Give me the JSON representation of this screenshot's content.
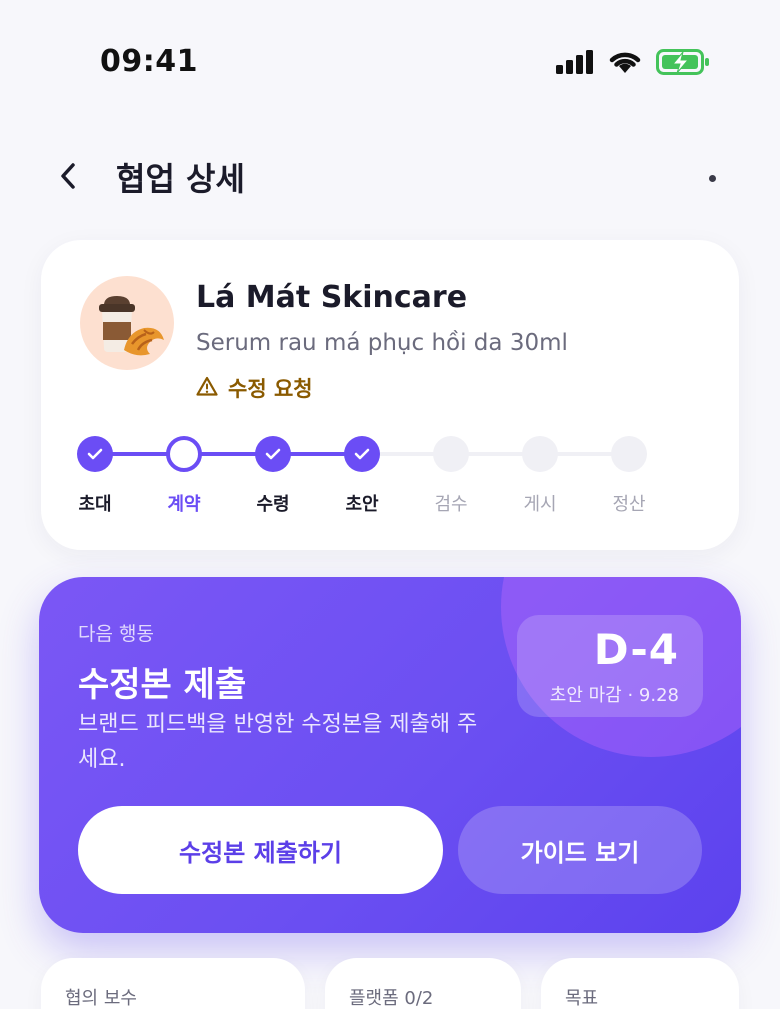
{
  "status_bar": {
    "time": "09:41",
    "icons": [
      "signal-icon",
      "wifi-icon",
      "battery-charging-icon"
    ]
  },
  "nav": {
    "title": "협업 상세",
    "back_icon": "chevron-left-icon",
    "more_icon": "more-horizontal-icon"
  },
  "collab": {
    "brand": "Lá Mát Skincare",
    "product": "Serum rau má phục hồi da 30ml",
    "status_icon": "warning-icon",
    "status_label": "수정 요청",
    "steps": [
      {
        "label": "초대",
        "state": "done"
      },
      {
        "label": "계약",
        "state": "current"
      },
      {
        "label": "수령",
        "state": "done"
      },
      {
        "label": "초안",
        "state": "done"
      },
      {
        "label": "검수",
        "state": "todo"
      },
      {
        "label": "게시",
        "state": "todo"
      },
      {
        "label": "정산",
        "state": "todo"
      }
    ]
  },
  "next_action": {
    "eyebrow": "다음 행동",
    "title": "수정본 제출",
    "description": "브랜드 피드백을 반영한 수정본을 제출해 주세요.",
    "dday": "D-4",
    "deadline": "초안 마감 · 9.28",
    "primary_button": "수정본 제출하기",
    "secondary_button": "가이드 보기"
  },
  "info_cards": [
    {
      "label": "협의 보수"
    },
    {
      "label": "플랫폼 0/2"
    },
    {
      "label": "목표"
    }
  ],
  "colors": {
    "accent": "#6b4df5",
    "warning": "#8a5a00",
    "background": "#f7f7fb"
  }
}
